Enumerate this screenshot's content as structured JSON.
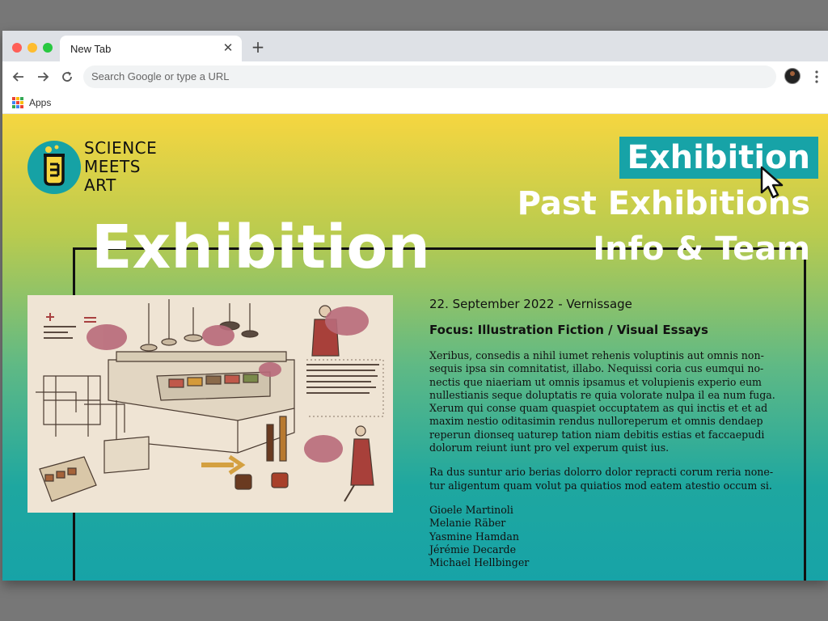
{
  "browser": {
    "tab_title": "New Tab",
    "omnibox_placeholder": "Search Google or type a URL",
    "bookmarks_apps_label": "Apps",
    "colors": {
      "tabstrip": "#dee1e6",
      "close_dot": "#ff5f57",
      "minimize_dot": "#febc2e",
      "maximize_dot": "#28c840"
    }
  },
  "site": {
    "logo": {
      "line1": "SCIENCE",
      "line2": "MEETS",
      "line3": "ART"
    },
    "nav": {
      "exhibition": "Exhibition",
      "past_exhibitions": "Past Exhibitions",
      "info_team": "Info & Team"
    },
    "page_title": "Exhibition",
    "content": {
      "date": "22. September 2022 - Vernissage",
      "focus": "Focus: Illustration Fiction / Visual Essays",
      "paragraph1": "Xeribus, consedis a nihil iumet rehenis voluptinis aut omnis non-sequis ipsa sin comnitatist, illabo. Nequissi coria cus eumqui no-nectis que niaeriam ut omnis ipsamus et volupienis experio eum nullestianis seque doluptatis re quia volorate nulpa il ea num fuga. Xerum qui conse quam quaspiet occuptatem as qui inctis et et ad maxim nestio oditasimin rendus nulloreperum et omnis dendaep reperun dionseq uaturep tation niam debitis estias et faccaepudi dolorum reiunt iunt pro vel experum quist ius.",
      "paragraph2": "Ra dus suntur ario berias dolorro dolor repracti corum reria none-tur aligentum quam volut pa quiatios mod eatem atestio occum si.",
      "names": [
        "Gioele Martinoli",
        "Melanie Räber",
        "Yasmine Hamdan",
        "Jérémie Decarde",
        "Michael Hellbinger"
      ]
    },
    "colors": {
      "accent_teal": "#17a3a7",
      "gradient_top": "#f6d640",
      "gradient_bottom": "#17a3a7"
    },
    "icons": {
      "logo": "flask-logo-icon",
      "cursor": "mouse-pointer-icon"
    }
  }
}
